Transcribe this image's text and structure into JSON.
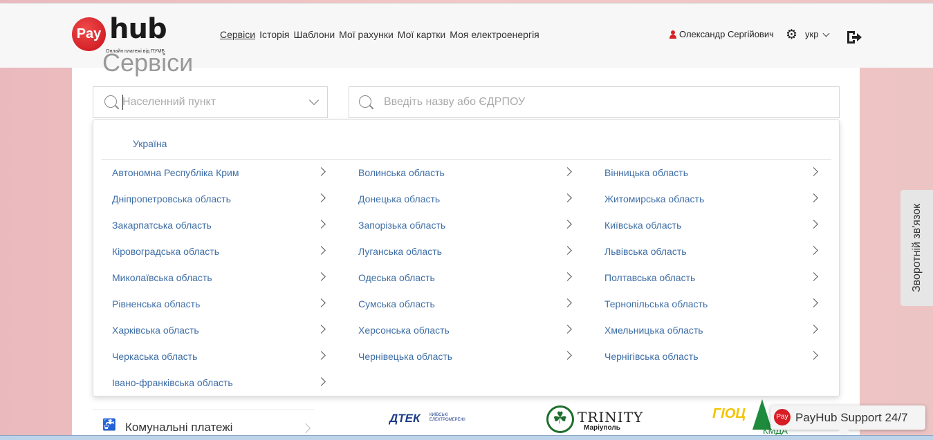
{
  "header": {
    "logo": {
      "mark": "Pay",
      "word": "hub",
      "tagline": "Онлайн платежі від ПУМБ"
    },
    "nav": [
      "Сервіси",
      "Історія",
      "Шаблони",
      "Мої рахунки",
      "Мої картки",
      "Моя електроенергія"
    ],
    "active_nav": "Сервіси",
    "user_name": "Олександр Сергійович",
    "lang": "укр",
    "icons": {
      "user": "user-icon",
      "settings": "gear-icon",
      "logout": "logout-icon"
    },
    "accent_color": "#d42424"
  },
  "page_title": "Сервіси",
  "filters": {
    "city_placeholder": "Населенний пункт",
    "search_placeholder": "Введіть назву або ЄДРПОУ"
  },
  "dropdown": {
    "country": "Україна",
    "regions": [
      "Автономна Республіка Крим",
      "Волинська область",
      "Вінницька область",
      "Дніпропетровська область",
      "Донецька область",
      "Житомирська область",
      "Закарпатська область",
      "Запорізька область",
      "Київська область",
      "Кіровоградська область",
      "Луганська область",
      "Львівська область",
      "Миколаївська область",
      "Одеська область",
      "Полтавська область",
      "Рівненська область",
      "Сумська область",
      "Тернопільська область",
      "Харківська область",
      "Херсонська область",
      "Хмельницька область",
      "Черкаська область",
      "Чернівецька область",
      "Чернігівська область",
      "Івано-франківська область"
    ],
    "link_color": "#3e6ea6"
  },
  "categories": [
    {
      "label": "Комунальні платежі",
      "icon": "tap-icon"
    }
  ],
  "provider_logos": {
    "dtek": {
      "name": "ДТЕК",
      "sub": "КИЇВСЬКІ ЕЛЕКТРОМЕРЕЖІ"
    },
    "trinity": {
      "name": "TRINITY",
      "sub": "Маріуполь"
    },
    "gioc": {
      "name": "ГІОЦ",
      "sub": "КМДА"
    }
  },
  "feedback_label": "Зворотній зв'язок",
  "support": {
    "logo": "Pay",
    "label": "PayHub Support 24/7"
  }
}
